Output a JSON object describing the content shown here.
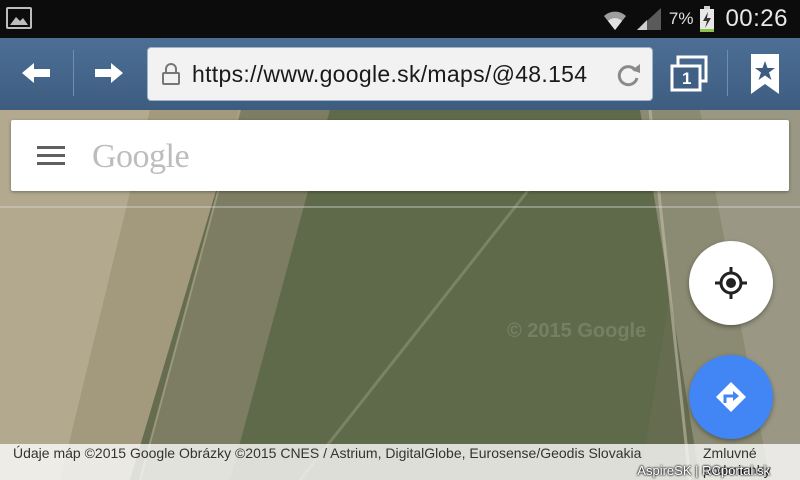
{
  "status_bar": {
    "battery_pct": "7%",
    "time": "00:26"
  },
  "browser": {
    "url": "https://www.google.sk/maps/@48.154",
    "tab_count": "1"
  },
  "map": {
    "search_logo": "Google",
    "watermark": "© 2015 Google",
    "attribution": "Údaje máp ©2015 Google Obrázky ©2015 CNES / Astrium, DigitalGlobe, Eurosense/Geodis Slovakia",
    "terms_link": "Zmluvné podmienky",
    "site_credit": "AspireSK | RCportal.sk"
  },
  "icons": {
    "status": [
      "gallery-icon",
      "wifi-icon",
      "signal-icon",
      "battery-charging-icon"
    ],
    "browser": [
      "back-arrow-icon",
      "forward-arrow-icon",
      "lock-icon",
      "reload-icon",
      "tabs-icon",
      "bookmark-star-icon"
    ],
    "map": [
      "menu-icon",
      "my-location-icon",
      "directions-icon"
    ]
  },
  "colors": {
    "accent_blue": "#4285f4",
    "browser_bar": "#46678c",
    "battery_green": "#8bc34a"
  }
}
